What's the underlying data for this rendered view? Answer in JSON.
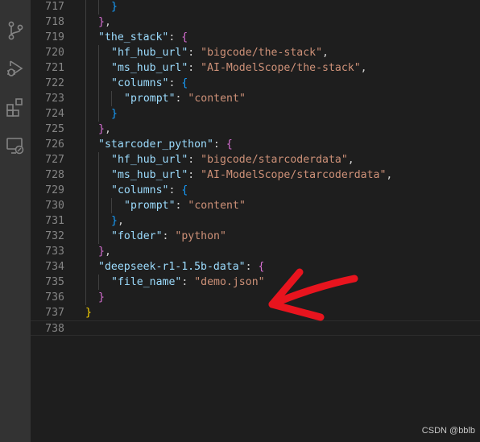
{
  "activity_bar": {
    "icons": [
      "source-control-icon",
      "run-debug-icon",
      "extensions-icon",
      "remote-explorer-icon"
    ]
  },
  "editor": {
    "lines": [
      {
        "num": "717",
        "indent": 2,
        "tokens": [
          {
            "t": "}",
            "c": "b3"
          }
        ]
      },
      {
        "num": "718",
        "indent": 1,
        "tokens": [
          {
            "t": "}",
            "c": "b2"
          },
          {
            "t": ",",
            "c": "p"
          }
        ]
      },
      {
        "num": "719",
        "indent": 1,
        "tokens": [
          {
            "t": "\"the_stack\"",
            "c": "k"
          },
          {
            "t": ": ",
            "c": "p"
          },
          {
            "t": "{",
            "c": "b2"
          }
        ]
      },
      {
        "num": "720",
        "indent": 2,
        "tokens": [
          {
            "t": "\"hf_hub_url\"",
            "c": "k"
          },
          {
            "t": ": ",
            "c": "p"
          },
          {
            "t": "\"bigcode/the-stack\"",
            "c": "s"
          },
          {
            "t": ",",
            "c": "p"
          }
        ]
      },
      {
        "num": "721",
        "indent": 2,
        "tokens": [
          {
            "t": "\"ms_hub_url\"",
            "c": "k"
          },
          {
            "t": ": ",
            "c": "p"
          },
          {
            "t": "\"AI-ModelScope/the-stack\"",
            "c": "s"
          },
          {
            "t": ",",
            "c": "p"
          }
        ]
      },
      {
        "num": "722",
        "indent": 2,
        "tokens": [
          {
            "t": "\"columns\"",
            "c": "k"
          },
          {
            "t": ": ",
            "c": "p"
          },
          {
            "t": "{",
            "c": "b3"
          }
        ]
      },
      {
        "num": "723",
        "indent": 3,
        "tokens": [
          {
            "t": "\"prompt\"",
            "c": "k"
          },
          {
            "t": ": ",
            "c": "p"
          },
          {
            "t": "\"content\"",
            "c": "s"
          }
        ]
      },
      {
        "num": "724",
        "indent": 2,
        "tokens": [
          {
            "t": "}",
            "c": "b3"
          }
        ]
      },
      {
        "num": "725",
        "indent": 1,
        "tokens": [
          {
            "t": "}",
            "c": "b2"
          },
          {
            "t": ",",
            "c": "p"
          }
        ]
      },
      {
        "num": "726",
        "indent": 1,
        "tokens": [
          {
            "t": "\"starcoder_python\"",
            "c": "k"
          },
          {
            "t": ": ",
            "c": "p"
          },
          {
            "t": "{",
            "c": "b2"
          }
        ]
      },
      {
        "num": "727",
        "indent": 2,
        "tokens": [
          {
            "t": "\"hf_hub_url\"",
            "c": "k"
          },
          {
            "t": ": ",
            "c": "p"
          },
          {
            "t": "\"bigcode/starcoderdata\"",
            "c": "s"
          },
          {
            "t": ",",
            "c": "p"
          }
        ]
      },
      {
        "num": "728",
        "indent": 2,
        "tokens": [
          {
            "t": "\"ms_hub_url\"",
            "c": "k"
          },
          {
            "t": ": ",
            "c": "p"
          },
          {
            "t": "\"AI-ModelScope/starcoderdata\"",
            "c": "s"
          },
          {
            "t": ",",
            "c": "p"
          }
        ]
      },
      {
        "num": "729",
        "indent": 2,
        "tokens": [
          {
            "t": "\"columns\"",
            "c": "k"
          },
          {
            "t": ": ",
            "c": "p"
          },
          {
            "t": "{",
            "c": "b3"
          }
        ]
      },
      {
        "num": "730",
        "indent": 3,
        "tokens": [
          {
            "t": "\"prompt\"",
            "c": "k"
          },
          {
            "t": ": ",
            "c": "p"
          },
          {
            "t": "\"content\"",
            "c": "s"
          }
        ]
      },
      {
        "num": "731",
        "indent": 2,
        "tokens": [
          {
            "t": "}",
            "c": "b3"
          },
          {
            "t": ",",
            "c": "p"
          }
        ]
      },
      {
        "num": "732",
        "indent": 2,
        "tokens": [
          {
            "t": "\"folder\"",
            "c": "k"
          },
          {
            "t": ": ",
            "c": "p"
          },
          {
            "t": "\"python\"",
            "c": "s"
          }
        ]
      },
      {
        "num": "733",
        "indent": 1,
        "tokens": [
          {
            "t": "}",
            "c": "b2"
          },
          {
            "t": ",",
            "c": "p"
          }
        ]
      },
      {
        "num": "734",
        "indent": 1,
        "tokens": [
          {
            "t": "\"deepseek-r1-1.5b-data\"",
            "c": "k"
          },
          {
            "t": ": ",
            "c": "p"
          },
          {
            "t": "{",
            "c": "b2"
          }
        ]
      },
      {
        "num": "735",
        "indent": 2,
        "tokens": [
          {
            "t": "\"file_name\"",
            "c": "k"
          },
          {
            "t": ": ",
            "c": "p"
          },
          {
            "t": "\"demo.json\"",
            "c": "s"
          }
        ]
      },
      {
        "num": "736",
        "indent": 1,
        "tokens": [
          {
            "t": "}",
            "c": "b2"
          }
        ]
      },
      {
        "num": "737",
        "indent": 0,
        "tokens": [
          {
            "t": "}",
            "c": "b1"
          }
        ]
      },
      {
        "num": "738",
        "indent": 0,
        "tokens": [],
        "current": true
      }
    ]
  },
  "annotation": {
    "shape": "arrow",
    "color": "#e8141e"
  },
  "watermark": "CSDN @bblb"
}
